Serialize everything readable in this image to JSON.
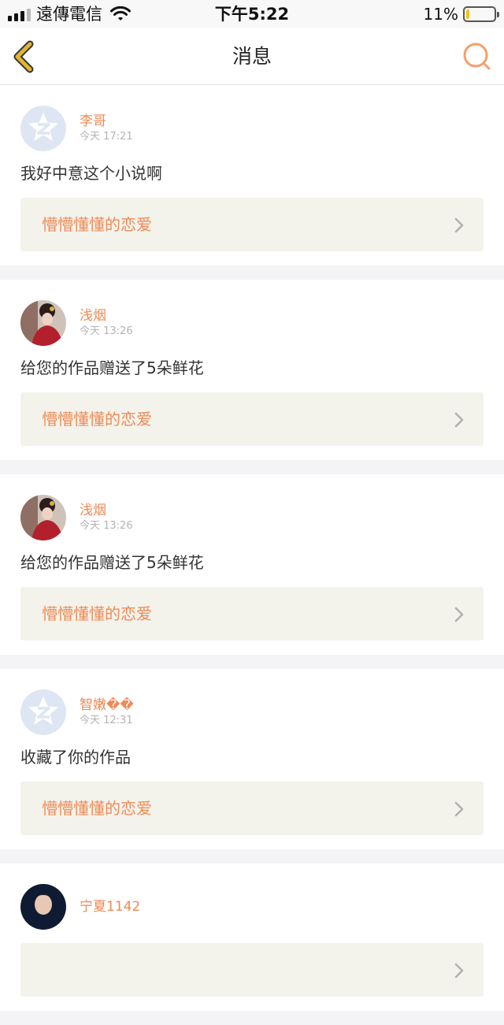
{
  "status_bar": {
    "carrier": "遠傳電信",
    "time": "下午5:22",
    "battery": "11%",
    "battery_level": 0.11,
    "signal_bars": 4,
    "signal_active": 3
  },
  "nav": {
    "title": "消息",
    "back_icon": "chevron-left-icon",
    "search_icon": "search-icon"
  },
  "colors": {
    "accent": "#ef8a56",
    "back_icon": "#e3b52b",
    "link_bg": "#f3f3ec"
  },
  "messages": [
    {
      "name": "李哥",
      "time": "今天 17:21",
      "text": "我好中意这个小说啊",
      "work": "懵懵懂懂的恋爱",
      "avatar": "default"
    },
    {
      "name": "浅烟",
      "time": "今天 13:26",
      "text": "给您的作品赠送了5朵鲜花",
      "work": "懵懵懂懂的恋爱",
      "avatar": "photo-woman"
    },
    {
      "name": "浅烟",
      "time": "今天 13:26",
      "text": "给您的作品赠送了5朵鲜花",
      "work": "懵懵懂懂的恋爱",
      "avatar": "photo-woman"
    },
    {
      "name": "智嫩��",
      "time": "今天 12:31",
      "text": "收藏了你的作品",
      "work": "懵懵懂懂的恋爱",
      "avatar": "default"
    },
    {
      "name": "宁夏1142",
      "time": "",
      "text": "",
      "work": "",
      "avatar": "photo-dark"
    }
  ]
}
